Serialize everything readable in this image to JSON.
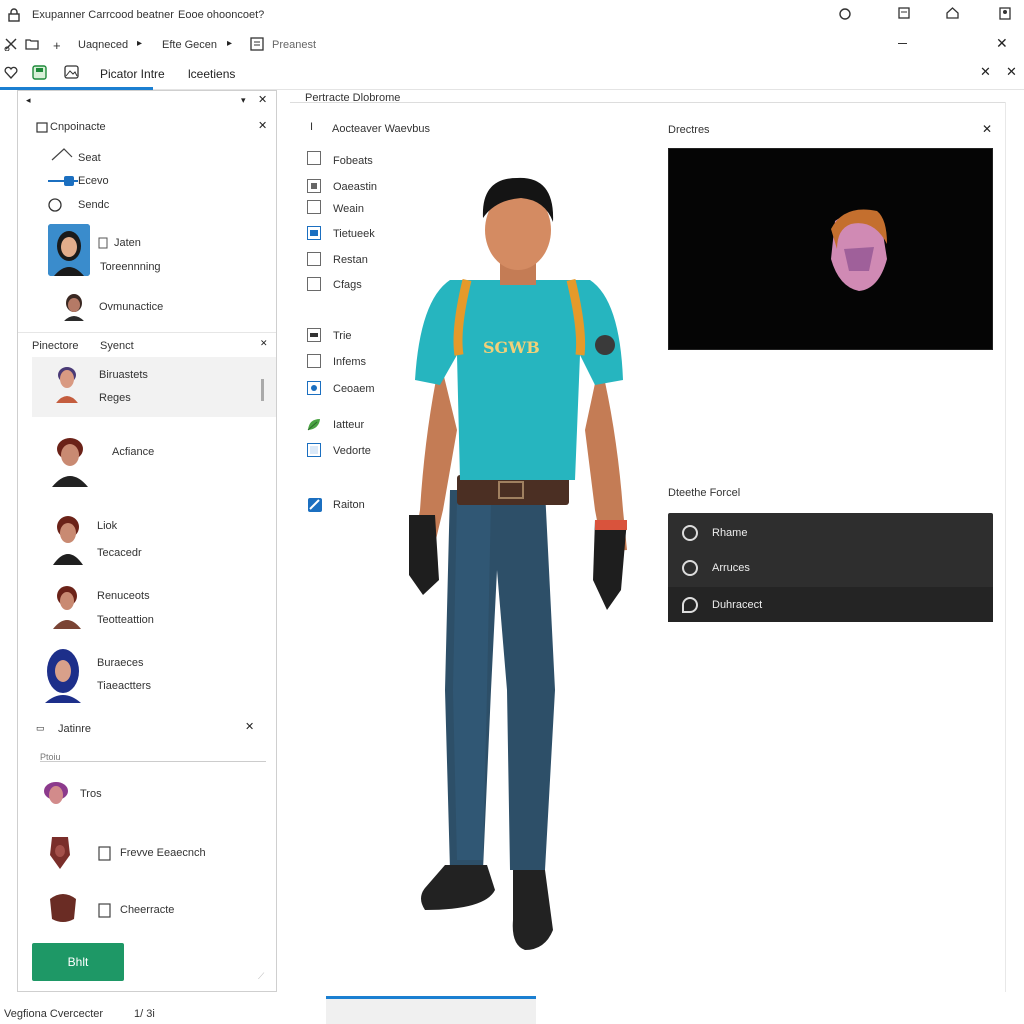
{
  "titlebar": {
    "title": "Exupanner Carrcood beatner",
    "subtitle": "Eooe ohooncoet?"
  },
  "toolbar": {
    "item1": "Uaqneced",
    "item2": "Efte Gecen",
    "item3": "Preanest"
  },
  "tabs": {
    "tab1": "Picator Intre",
    "tab2": "lceetiens"
  },
  "left_panel": {
    "section1_title": "Cnpoinacte",
    "tools": [
      "Seat",
      "Ecevo",
      "Sendc"
    ],
    "featured_name": "Jaten",
    "featured_desc": "Toreennning",
    "featured2": "Ovmunactice",
    "section2_title": "Pinectore",
    "section2_sub": "Syenct",
    "characters": [
      {
        "name": "Biruastets",
        "desc": "Reges"
      },
      {
        "name": "",
        "desc": "Acfiance"
      },
      {
        "name": "Liok",
        "desc": "Tecacedr"
      },
      {
        "name": "Renuceots",
        "desc": "Teotteattion"
      },
      {
        "name": "Buraeces",
        "desc": "Tiaeactters"
      }
    ],
    "section3_title": "Jatinre",
    "section3_search": "Ptoiu",
    "assets": [
      {
        "label": "Tros"
      },
      {
        "label": "Frevve Eeaecnch"
      },
      {
        "label": "Cheerracte"
      }
    ],
    "primary_button": "Bhlt"
  },
  "options": {
    "header": "Pertracte Dlobrome",
    "group1_title": "Aocteaver Waevbus",
    "group1": [
      "Fobeats",
      "Oaeastin",
      "Weain",
      "Tietueek",
      "Restan",
      "Cfags"
    ],
    "group2": [
      "Trie",
      "Infems",
      "Ceoaem"
    ],
    "group3": [
      "Iatteur",
      "Vedorte"
    ],
    "group4": [
      "Raiton"
    ]
  },
  "model": {
    "shirt_text": "SGWB"
  },
  "right_panel": {
    "preview_title": "Drectres",
    "detail_title": "Dteethe Forcel",
    "menu": [
      "Rhame",
      "Arruces",
      "Duhracect"
    ]
  },
  "statusbar": {
    "text": "Vegfiona Cvercecter",
    "page": "1/ 3i"
  },
  "colors": {
    "accent": "#1b7fd1",
    "primary": "#1e9866",
    "shirt": "#26b5bf",
    "jeans": "#2d4f68"
  }
}
